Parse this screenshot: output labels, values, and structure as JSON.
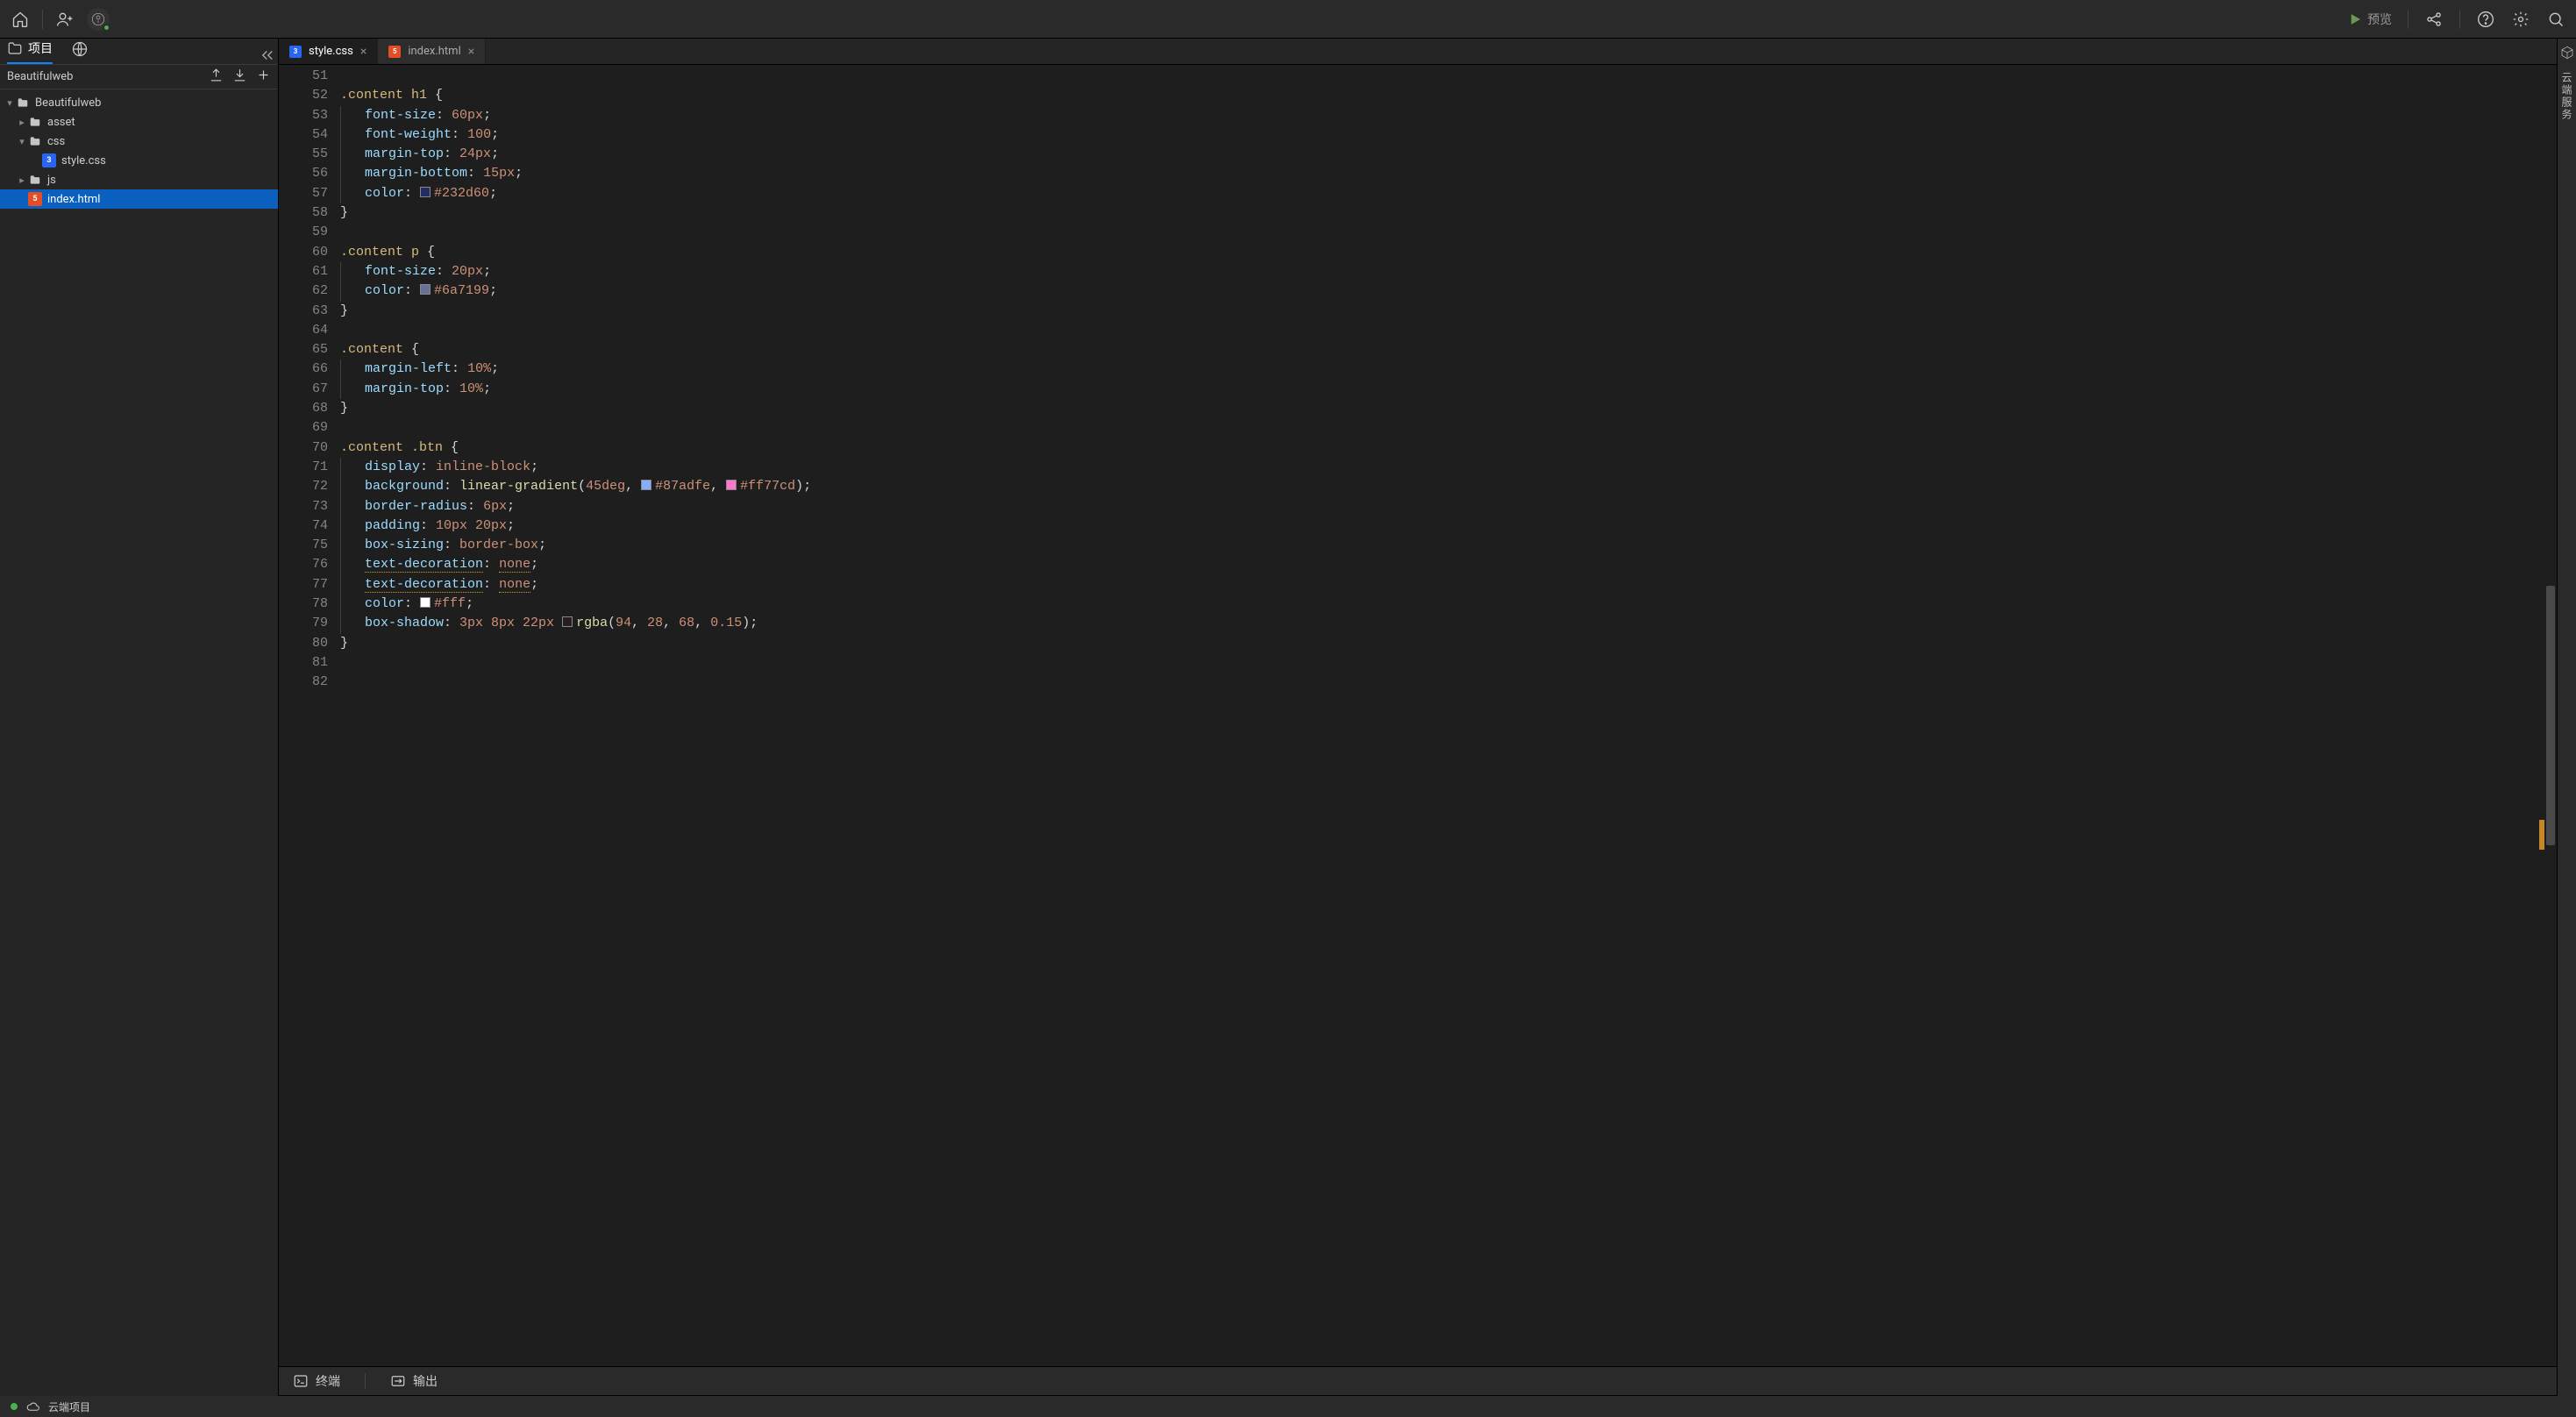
{
  "titlebar": {
    "preview_label": "预览"
  },
  "sidebar": {
    "tab_project": "项目",
    "project_name": "Beautifulweb",
    "tree": {
      "root": "Beautifulweb",
      "asset": "asset",
      "css": "css",
      "stylecss": "style.css",
      "js": "js",
      "indexhtml": "index.html"
    }
  },
  "tabs": {
    "stylecss": "style.css",
    "indexhtml": "index.html"
  },
  "panel": {
    "terminal": "终端",
    "output": "输出"
  },
  "status": {
    "cloud_project": "云端项目"
  },
  "rightrail": {
    "cloud_service": "云端服务"
  },
  "editor": {
    "first_line_no": 51,
    "lines": [
      "",
      ".content h1 {",
      "    font-size: 60px;",
      "    font-weight: 100;",
      "    margin-top: 24px;",
      "    margin-bottom: 15px;",
      "    color: #232d60;",
      "}",
      "",
      ".content p {",
      "    font-size: 20px;",
      "    color: #6a7199;",
      "}",
      "",
      ".content {",
      "    margin-left: 10%;",
      "    margin-top: 10%;",
      "}",
      "",
      ".content .btn {",
      "    display: inline-block;",
      "    background: linear-gradient(45deg, #87adfe, #ff77cd);",
      "    border-radius: 6px;",
      "    padding: 10px 20px;",
      "    box-sizing: border-box;",
      "    text-decoration: none;",
      "    text-decoration: none;",
      "    color: #fff;",
      "    box-shadow: 3px 8px 22px rgba(94, 28, 68, 0.15);",
      "}",
      "",
      ""
    ],
    "swatches": {
      "57": "#232d60",
      "62": "#6a7199",
      "72a": "#87adfe",
      "72b": "#ff77cd",
      "78": "#ffffff",
      "79": "rgba(94,28,68,0.15)"
    }
  }
}
